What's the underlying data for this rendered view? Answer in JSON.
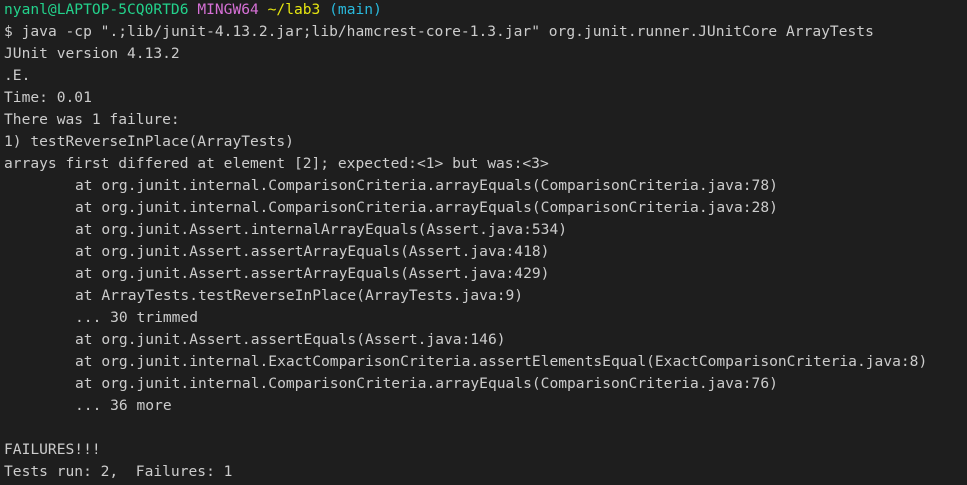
{
  "prompt": {
    "user_host": "nyanl@LAPTOP-5CQ0RTD6",
    "system": "MINGW64",
    "cwd": "~/lab3",
    "branch": "(main)",
    "symbol": "$",
    "command": "java -cp \".;lib/junit-4.13.2.jar;lib/hamcrest-core-1.3.jar\" org.junit.runner.JUnitCore ArrayTests"
  },
  "output": {
    "junit_version": "JUnit version 4.13.2",
    "progress": ".E.",
    "time": "Time: 0.01",
    "failure_count_line": "There was 1 failure:",
    "failure_header": "1) testReverseInPlace(ArrayTests)",
    "failure_message": "arrays first differed at element [2]; expected:<1> but was:<3>",
    "stack_trace": [
      "at org.junit.internal.ComparisonCriteria.arrayEquals(ComparisonCriteria.java:78)",
      "at org.junit.internal.ComparisonCriteria.arrayEquals(ComparisonCriteria.java:28)",
      "at org.junit.Assert.internalArrayEquals(Assert.java:534)",
      "at org.junit.Assert.assertArrayEquals(Assert.java:418)",
      "at org.junit.Assert.assertArrayEquals(Assert.java:429)",
      "at ArrayTests.testReverseInPlace(ArrayTests.java:9)",
      "... 30 trimmed",
      "at org.junit.Assert.assertEquals(Assert.java:146)",
      "at org.junit.internal.ExactComparisonCriteria.assertElementsEqual(ExactComparisonCriteria.java:8)",
      "at org.junit.internal.ComparisonCriteria.arrayEquals(ComparisonCriteria.java:76)",
      "... 36 more"
    ],
    "failures_banner": "FAILURES!!!",
    "summary": "Tests run: 2,  Failures: 1"
  },
  "colors": {
    "background": "#1e1e1e",
    "foreground": "#cccccc",
    "user_host": "#23d18b",
    "system": "#d670d6",
    "cwd": "#e5e510",
    "branch": "#29b8db"
  }
}
